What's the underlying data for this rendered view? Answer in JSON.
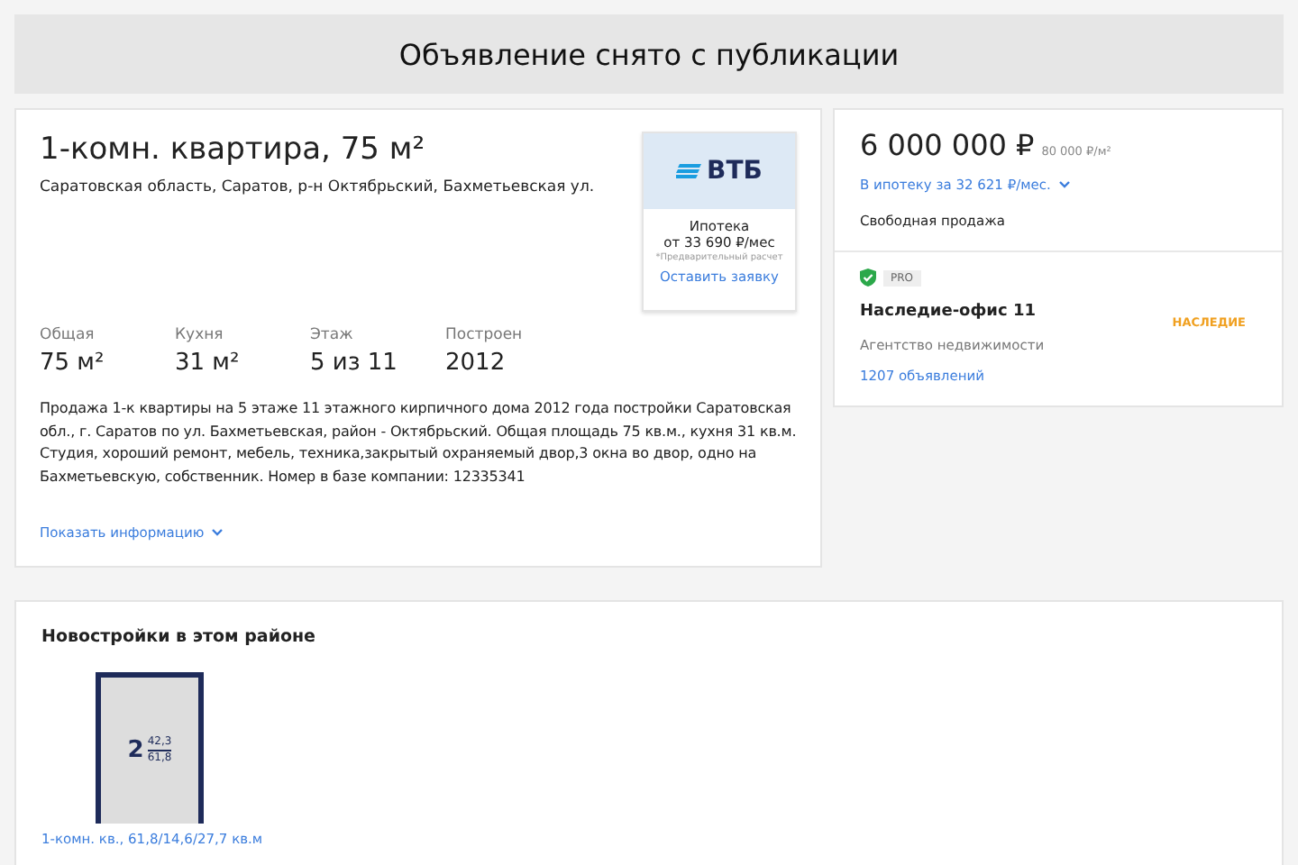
{
  "banner": {
    "title": "Объявление снято с публикации"
  },
  "listing": {
    "title": "1-комн. квартира, 75 м²",
    "address": "Саратовская область, Саратов, р-н Октябрьский, Бахметьевская ул.",
    "facts": [
      {
        "label": "Общая",
        "value": "75 м²"
      },
      {
        "label": "Кухня",
        "value": "31 м²"
      },
      {
        "label": "Этаж",
        "value": "5 из 11"
      },
      {
        "label": "Построен",
        "value": "2012"
      }
    ],
    "description": "Продажа 1-к квартиры на 5 этаже 11 этажного кирпичного дома 2012 года постройки Саратовская обл., г. Саратов по ул. Бахметьевская, район - Октябрьский. Общая площадь 75 кв.м., кухня 31 кв.м. Студия, хороший ремонт, мебель, техника,закрытый охраняемый двор,3 окна во двор, одно на Бахметьевскую, собственник. Номер в базе компании: 12335341",
    "more_link": "Показать информацию"
  },
  "bank_ad": {
    "logo": "ВТБ",
    "title": "Ипотека",
    "payment": "от 33 690 ₽/мес",
    "footnote": "*Предварительный расчет",
    "action": "Оставить заявку"
  },
  "price": {
    "amount": "6 000 000 ₽",
    "per_meter": "80 000 ₽/м²",
    "mortgage": "В ипотеку за 32 621 ₽/мес.",
    "sale_type": "Свободная продажа"
  },
  "agent": {
    "badge": "PRO",
    "verified": true,
    "name": "Наследие-офис 11",
    "type": "Агентство недвижимости",
    "listings": "1207 объявлений",
    "logo": "НАСЛЕДИЕ"
  },
  "new_buildings": {
    "title": "Новостройки в этом районе",
    "items": [
      {
        "rooms": "2",
        "area_living": "42,3",
        "area_total": "61,8",
        "caption": "1-комн. кв., 61,8/14,6/27,7 кв.м"
      }
    ]
  }
}
